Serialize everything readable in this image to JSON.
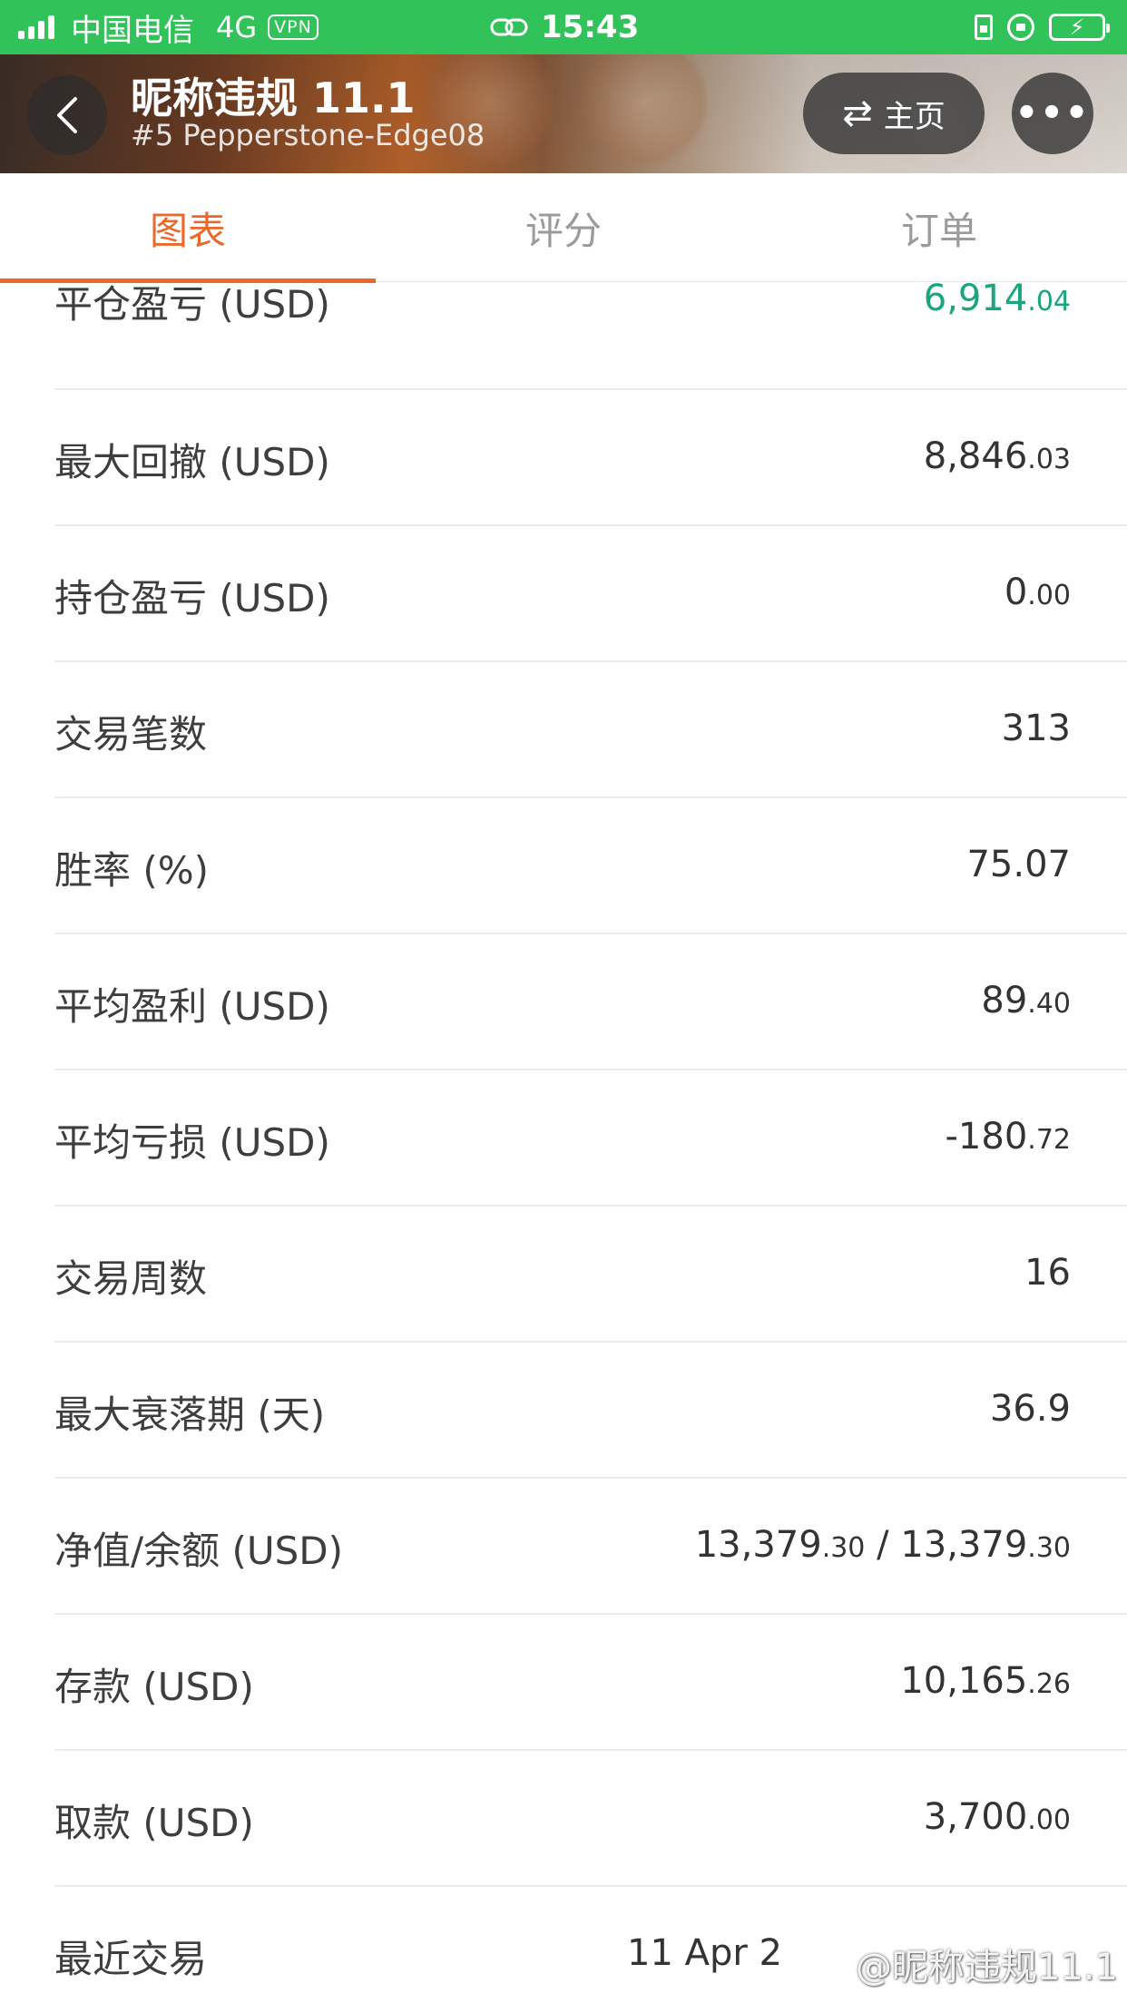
{
  "status_bar": {
    "carrier": "中国电信",
    "network": "4G",
    "vpn": "VPN",
    "time": "15:43"
  },
  "header": {
    "title": "昵称违规 11.1",
    "subtitle": "#5 Pepperstone-Edge08",
    "home_label": "主页",
    "more_label": "•••"
  },
  "tabs": [
    {
      "label": "图表",
      "active": true
    },
    {
      "label": "评分",
      "active": false
    },
    {
      "label": "订单",
      "active": false
    }
  ],
  "stats": [
    {
      "label": "平仓盈亏 (USD)",
      "main": "6,914",
      "dec": ".04",
      "color": "#1aa57e"
    },
    {
      "label": "最大回撤 (USD)",
      "main": "8,846",
      "dec": ".03"
    },
    {
      "label": "持仓盈亏 (USD)",
      "main": "0",
      "dec": ".00"
    },
    {
      "label": "交易笔数",
      "main": "313",
      "dec": ""
    },
    {
      "label": "胜率 (%)",
      "main": "75.07",
      "dec": ""
    },
    {
      "label": "平均盈利 (USD)",
      "main": "89",
      "dec": ".40"
    },
    {
      "label": "平均亏损 (USD)",
      "main": "-180",
      "dec": ".72"
    },
    {
      "label": "交易周数",
      "main": "16",
      "dec": ""
    },
    {
      "label": "最大衰落期 (天)",
      "main": "36.9",
      "dec": ""
    },
    {
      "label": "净值/余额 (USD)",
      "main": "13,379",
      "dec": ".30",
      "main2": " / 13,379",
      "dec2": ".30"
    },
    {
      "label": "存款 (USD)",
      "main": "10,165",
      "dec": ".26"
    },
    {
      "label": "取款 (USD)",
      "main": "3,700",
      "dec": ".00"
    },
    {
      "label": "最近交易",
      "main": "11 Apr 2",
      "dec": ""
    }
  ],
  "watermark": "@昵称违规11.1",
  "colors": {
    "accent": "#e9692c",
    "positive": "#1aa57e",
    "status_bar": "#31c25a"
  }
}
